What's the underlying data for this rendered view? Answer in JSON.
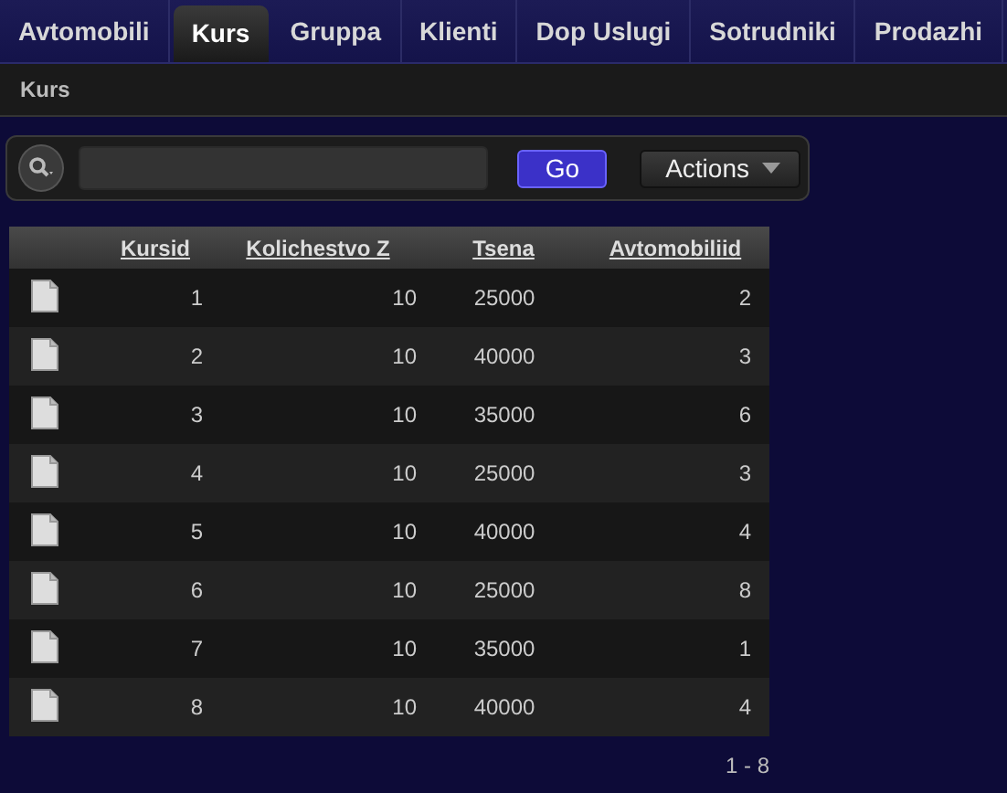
{
  "tabs": [
    {
      "label": "Avtomobili",
      "selected": false
    },
    {
      "label": "Kurs",
      "selected": true
    },
    {
      "label": "Gruppa",
      "selected": false
    },
    {
      "label": "Klienti",
      "selected": false
    },
    {
      "label": "Dop Uslugi",
      "selected": false
    },
    {
      "label": "Sotrudniki",
      "selected": false
    },
    {
      "label": "Prodazhi",
      "selected": false
    }
  ],
  "breadcrumb": "Kurs",
  "toolbar": {
    "go": "Go",
    "actions": "Actions"
  },
  "table": {
    "columns": [
      "Kursid",
      "Kolichestvo Z",
      "Tsena",
      "Avtomobiliid"
    ],
    "rows": [
      [
        "1",
        "10",
        "25000",
        "2"
      ],
      [
        "2",
        "10",
        "40000",
        "3"
      ],
      [
        "3",
        "10",
        "35000",
        "6"
      ],
      [
        "4",
        "10",
        "25000",
        "3"
      ],
      [
        "5",
        "10",
        "40000",
        "4"
      ],
      [
        "6",
        "10",
        "25000",
        "8"
      ],
      [
        "7",
        "10",
        "35000",
        "1"
      ],
      [
        "8",
        "10",
        "40000",
        "4"
      ]
    ]
  },
  "pagination": "1 - 8"
}
